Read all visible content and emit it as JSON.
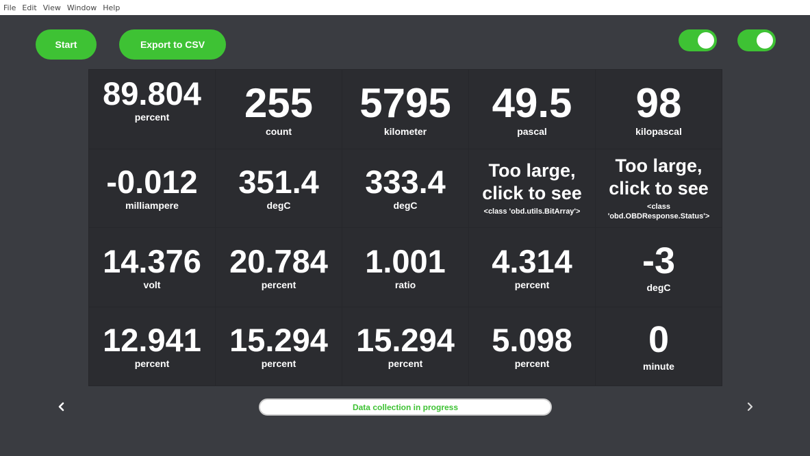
{
  "menu": [
    "File",
    "Edit",
    "View",
    "Window",
    "Help"
  ],
  "buttons": {
    "start": "Start",
    "export": "Export to CSV"
  },
  "toggles": [
    {
      "on": true
    },
    {
      "on": true
    }
  ],
  "cells": [
    {
      "value": "89.804",
      "unit": "percent",
      "size": "normal",
      "align": "top"
    },
    {
      "value": "255",
      "unit": "count",
      "size": "xl"
    },
    {
      "value": "5795",
      "unit": "kilometer",
      "size": "xl"
    },
    {
      "value": "49.5",
      "unit": "pascal",
      "size": "xl"
    },
    {
      "value": "98",
      "unit": "kilopascal",
      "size": "xl"
    },
    {
      "value": "-0.012",
      "unit": "milliampere",
      "size": "normal"
    },
    {
      "value": "351.4",
      "unit": "degC",
      "size": "normal"
    },
    {
      "value": "333.4",
      "unit": "degC",
      "size": "normal"
    },
    {
      "value": "Too large, click to see",
      "unit": "<class 'obd.utils.BitArray'>",
      "size": "small"
    },
    {
      "value": "Too large, click to see",
      "unit": "<class 'obd.OBDResponse.Status'>",
      "size": "small"
    },
    {
      "value": "14.376",
      "unit": "volt",
      "size": "normal"
    },
    {
      "value": "20.784",
      "unit": "percent",
      "size": "normal"
    },
    {
      "value": "1.001",
      "unit": "ratio",
      "size": "normal"
    },
    {
      "value": "4.314",
      "unit": "percent",
      "size": "normal"
    },
    {
      "value": "-3",
      "unit": "degC",
      "size": "big"
    },
    {
      "value": "12.941",
      "unit": "percent",
      "size": "normal"
    },
    {
      "value": "15.294",
      "unit": "percent",
      "size": "normal"
    },
    {
      "value": "15.294",
      "unit": "percent",
      "size": "normal"
    },
    {
      "value": "5.098",
      "unit": "percent",
      "size": "normal"
    },
    {
      "value": "0",
      "unit": "minute",
      "size": "big"
    }
  ],
  "nav": {
    "left_icon": "chevron-left-icon",
    "right_icon": "chevron-right-icon"
  },
  "status": "Data collection in progress",
  "colors": {
    "accent": "#3ec234",
    "background": "#3a3c41",
    "cell": "#2b2c30"
  }
}
